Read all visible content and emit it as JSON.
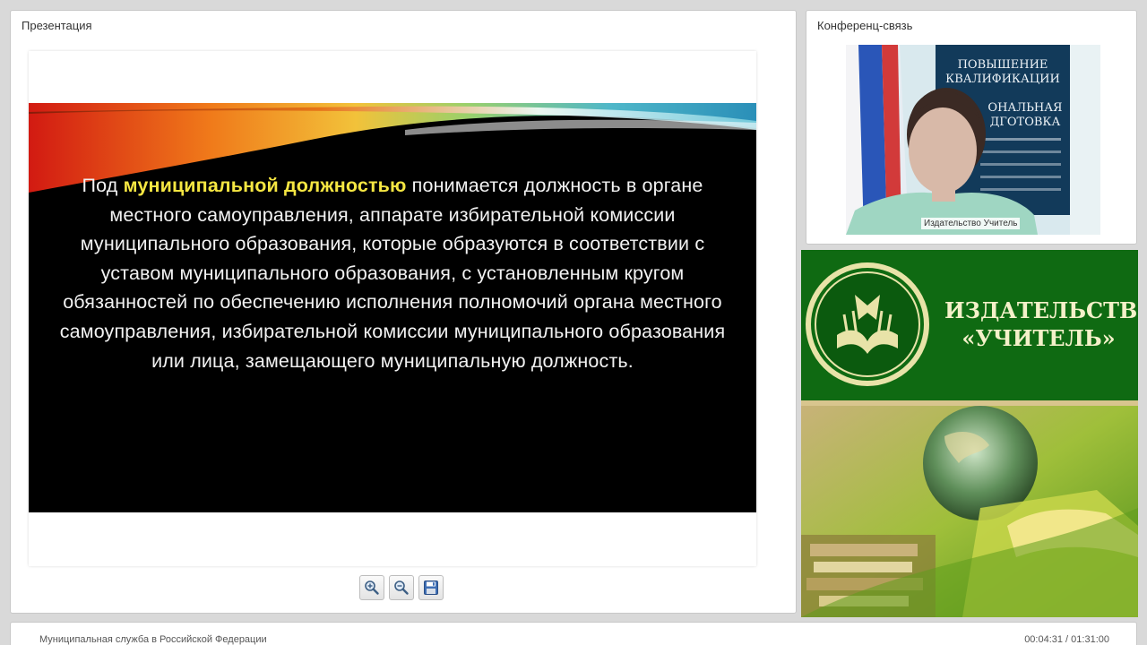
{
  "presentation": {
    "panel_title": "Презентация",
    "slide": {
      "text_before": "Под ",
      "highlight": "муниципальной должностью",
      "text_after": " понимается должность в органе местного самоуправления, аппарате избирательной комиссии муниципального образования, которые образуются в соответствии с уставом муниципального образования, с установленным кругом обязанностей по обеспечению исполнения полномочий органа местного самоуправления, избирательной комиссии муниципального образования или лица, замещающего муниципальную должность.",
      "highlight_color": "#f5e642"
    },
    "toolbar": {
      "zoom_in_icon": "zoom-in-icon",
      "zoom_out_icon": "zoom-out-icon",
      "save_icon": "floppy-disk-icon"
    }
  },
  "conference": {
    "panel_title": "Конференц-связь",
    "speaker_label": "Издательство Учитель",
    "poster_lines": [
      "ПОВЫШЕНИЕ",
      "КВАЛИФИКАЦИИ",
      "ОНАЛЬНАЯ",
      "ДГОТОВКА"
    ]
  },
  "banner": {
    "line1": "ИЗДАТЕЛЬСТВО",
    "line2": "«УЧИТЕЛЬ»",
    "brand_color": "#0f6a12"
  },
  "footer": {
    "course_title": "Муниципальная служба в Российской Федерации",
    "time": "00:04:31 / 01:31:00"
  }
}
